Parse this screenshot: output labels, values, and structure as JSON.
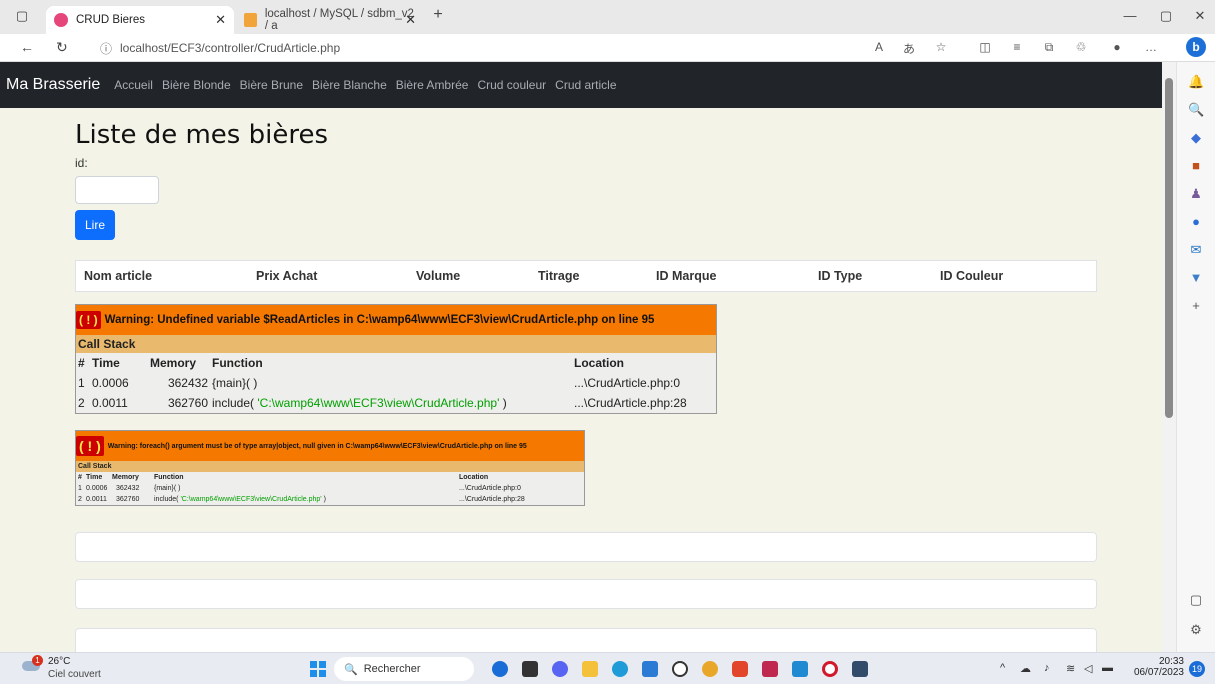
{
  "browser": {
    "tabs": [
      {
        "title": "CRUD Bieres",
        "active": true
      },
      {
        "title": "localhost / MySQL / sdbm_v2 / a",
        "active": false
      }
    ],
    "new_tab": "+",
    "url": "localhost/ECF3/controller/CrudArticle.php"
  },
  "nav": {
    "brand": "Ma Brasserie",
    "links": [
      "Accueil",
      "Bière Blonde",
      "Bière Brune",
      "Bière Blanche",
      "Bière Ambrée",
      "Crud couleur",
      "Crud article"
    ]
  },
  "page": {
    "title": "Liste de mes bières",
    "id_label": "id:",
    "button": "Lire",
    "columns": [
      "Nom article",
      "Prix Achat",
      "Volume",
      "Titrage",
      "ID Marque",
      "ID Type",
      "ID Couleur"
    ]
  },
  "warnings": [
    {
      "icon": "( ! )",
      "message": "Warning: Undefined variable $ReadArticles in C:\\wamp64\\www\\ECF3\\view\\CrudArticle.php on line 95",
      "call_stack": "Call Stack",
      "headers": [
        "#",
        "Time",
        "Memory",
        "Function",
        "Location"
      ],
      "rows": [
        {
          "n": "1",
          "time": "0.0006",
          "memory": "362432",
          "function": "{main}( )",
          "path": "",
          "location": "...\\CrudArticle.php:0"
        },
        {
          "n": "2",
          "time": "0.0011",
          "memory": "362760",
          "function": "include(",
          "path": "'C:\\wamp64\\www\\ECF3\\view\\CrudArticle.php'",
          "close": ")",
          "location": "...\\CrudArticle.php:28"
        }
      ]
    },
    {
      "icon": "( ! )",
      "message": "Warning: foreach() argument must be of type array|object, null given in C:\\wamp64\\www\\ECF3\\view\\CrudArticle.php on line 95",
      "call_stack": "Call Stack",
      "headers": [
        "#",
        "Time",
        "Memory",
        "Function",
        "Location"
      ],
      "rows": [
        {
          "n": "1",
          "time": "0.0006",
          "memory": "362432",
          "function": "{main}( )",
          "path": "",
          "location": "...\\CrudArticle.php:0"
        },
        {
          "n": "2",
          "time": "0.0011",
          "memory": "362760",
          "function": "include(",
          "path": "'C:\\wamp64\\www\\ECF3\\view\\CrudArticle.php'",
          "close": ")",
          "location": "...\\CrudArticle.php:28"
        }
      ]
    }
  ],
  "taskbar": {
    "temp": "26°C",
    "weather": "Ciel couvert",
    "weather_badge": "1",
    "search": "Rechercher",
    "time": "20:33",
    "date": "06/07/2023",
    "notif": "19"
  },
  "colors": {
    "navbar": "#212529",
    "page_bg": "#f3f4e7",
    "button": "#0d6efd",
    "xdebug_header": "#f57900",
    "xdebug_callstack": "#e9b96e"
  }
}
